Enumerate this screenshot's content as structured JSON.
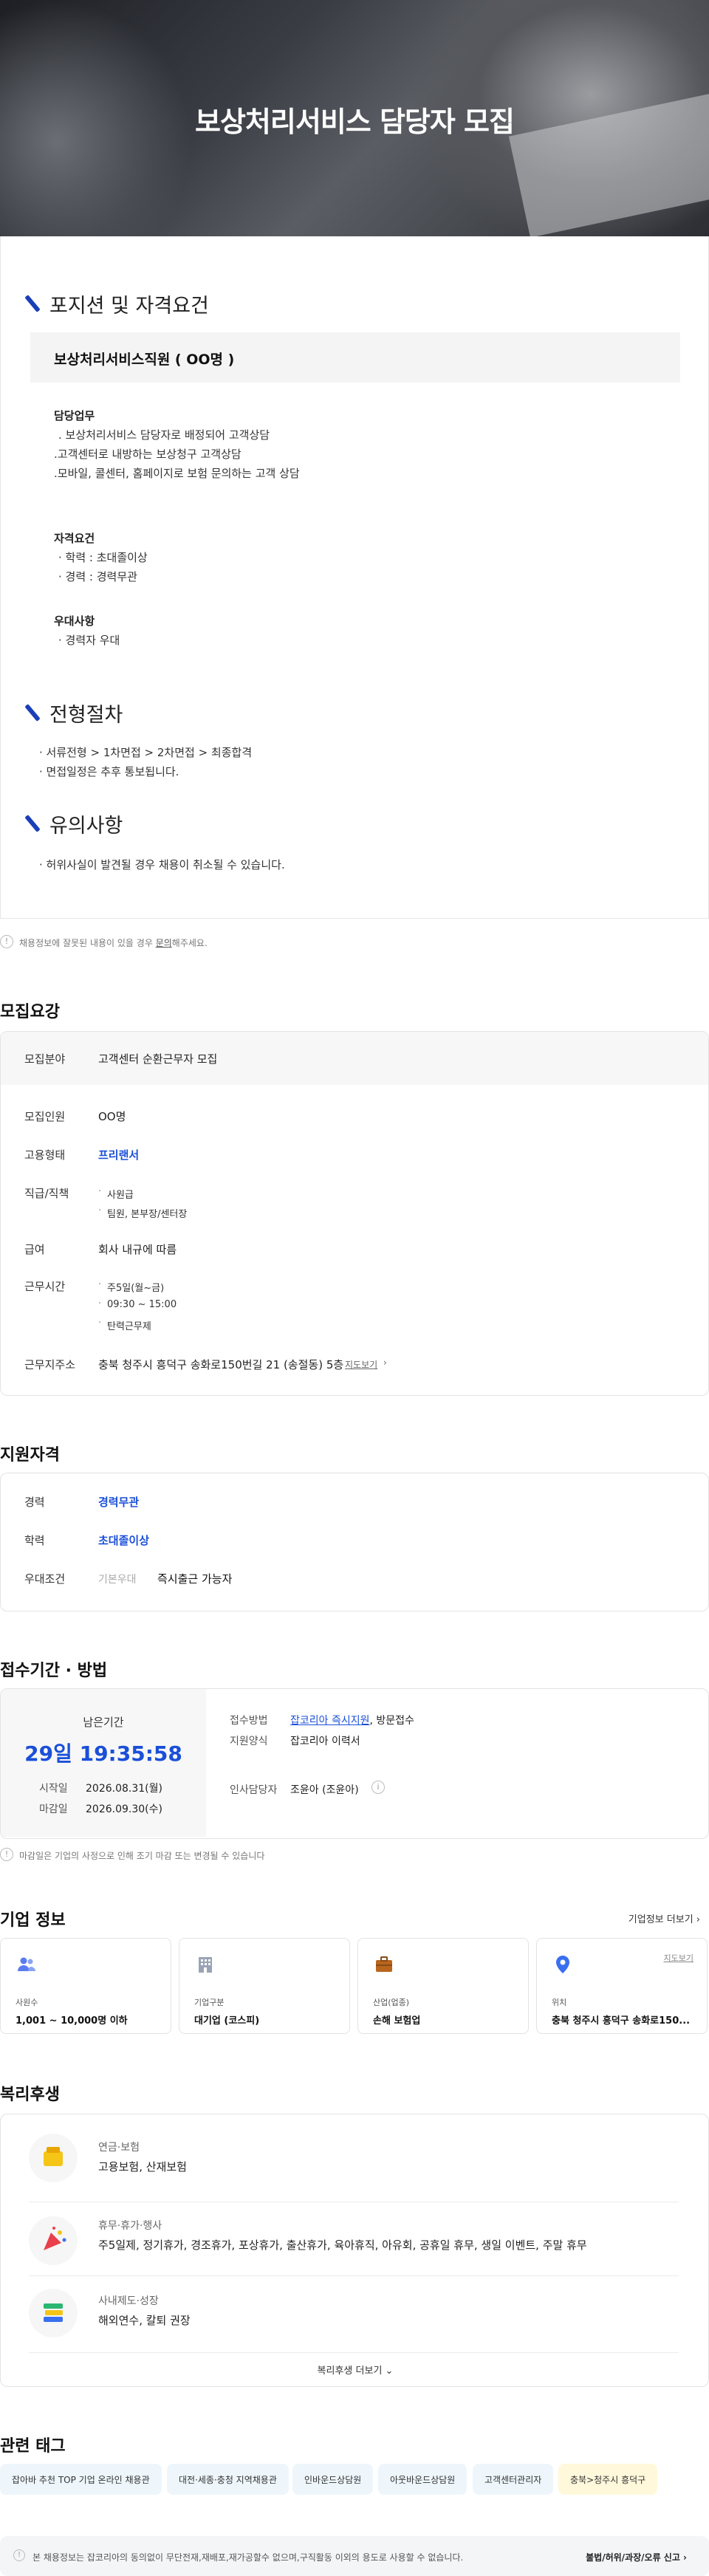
{
  "hero": {
    "title": "보상처리서비스 담당자 모집"
  },
  "detail": {
    "section1_title": "포지션 및 자격요건",
    "position": "보상처리서비스직원 ( OO명 )",
    "duty_label": "담당업무",
    "duties": [
      ". 보상처리서비스 담당자로 배정되어 고객상담",
      ".고객센터로 내방하는 보상청구 고객상담",
      ".모바일, 콜센터, 홈페이지로 보험 문의하는 고객 상담"
    ],
    "qual_label": "자격요건",
    "quals": [
      "· 학력 : 초대졸이상",
      "· 경력 : 경력무관"
    ],
    "pref_label": "우대사항",
    "prefs": [
      "· 경력자 우대"
    ],
    "section2_title": "전형절차",
    "process": [
      "· 서류전형 > 1차면접 > 2차면접 > 최종합격",
      "· 면접일정은 추후 통보됩니다."
    ],
    "section3_title": "유의사항",
    "notes": [
      "· 허위사실이 발견될 경우 채용이 취소될 수 있습니다."
    ]
  },
  "report": {
    "prefix": "채용정보에 잘못된 내용이 있을 경우 ",
    "link": "문의",
    "suffix": "해주세요."
  },
  "recruit": {
    "heading": "모집요강",
    "field_key": "모집분야",
    "field_val": "고객센터 순환근무자 모집",
    "count_key": "모집인원",
    "count_val": "OO명",
    "type_key": "고용형태",
    "type_val": "프리랜서",
    "rank_key": "직급/직책",
    "rank_vals": [
      "사원급",
      "팀원, 본부장/센터장"
    ],
    "pay_key": "급여",
    "pay_val": "회사 내규에 따름",
    "time_key": "근무시간",
    "time_vals": [
      "주5일(월~금)",
      "09:30 ~ 15:00",
      "탄력근무제"
    ],
    "addr_key": "근무지주소",
    "addr_val": "충북 청주시 흥덕구 송화로150번길 21 (송절동) 5층",
    "map": "지도보기"
  },
  "qual": {
    "heading": "지원자격",
    "career_key": "경력",
    "career_val": "경력무관",
    "edu_key": "학력",
    "edu_val": "초대졸이상",
    "pref_key": "우대조건",
    "pref_tag": "기본우대",
    "pref_val": "즉시출근 가능자"
  },
  "apply": {
    "heading": "접수기간 · 방법",
    "remain_label": "남은기간",
    "remain_val": "29일 19:35:58",
    "start_key": "시작일",
    "start_val": "2026.08.31(월)",
    "end_key": "마감일",
    "end_val": "2026.09.30(수)",
    "method_key": "접수방법",
    "method_link": "잡코리아 즉시지원",
    "method_rest": ", 방문접수",
    "form_key": "지원양식",
    "form_val": "잡코리아 이력서",
    "hr_key": "인사담당자",
    "hr_val": "조윤아 (조윤아)",
    "note": "마감일은 기업의 사정으로 인해 조기 마감 또는 변경될 수 있습니다"
  },
  "company": {
    "heading": "기업 정보",
    "more": "기업정보 더보기",
    "cards": [
      {
        "key": "사원수",
        "val": "1,001 ~ 10,000명 이하",
        "icon": "people-icon"
      },
      {
        "key": "기업구분",
        "val": "대기업 (코스피)",
        "icon": "building-icon"
      },
      {
        "key": "산업(업종)",
        "val": "손해 보험업",
        "icon": "briefcase-icon"
      },
      {
        "key": "위치",
        "val": "충북 청주시 흥덕구 송화로150...",
        "icon": "location-icon",
        "map": "지도보기"
      }
    ]
  },
  "welfare": {
    "heading": "복리후생",
    "items": [
      {
        "key": "연금·보험",
        "val": "고용보험, 산재보험"
      },
      {
        "key": "휴무·휴가·행사",
        "val": "주5일제, 정기휴가, 경조휴가, 포상휴가, 출산휴가, 육아휴직, 아유회, 공휴일 휴무, 생일 이벤트, 주말 휴무"
      },
      {
        "key": "사내제도·성장",
        "val": "해외연수, 칼퇴 권장"
      }
    ],
    "more": "복리후생 더보기"
  },
  "tags": {
    "heading": "관련 태그",
    "items": [
      "잡아바 추천 TOP 기업 온라인 채용관",
      "대전·세종·충청 지역채용관",
      "인바운드상담원",
      "아웃바운드상담원",
      "고객센터관리자",
      "충북>청주시 흥덕구"
    ]
  },
  "footer": {
    "text": "본 채용정보는 잡코리아의 동의없이 무단전재,재배포,재가공할수 없으며,구직활동 이외의 용도로 사용할 수 없습니다.",
    "report": "불법/허위/과장/오류 신고"
  },
  "colors": {
    "accent_blue": "#1a4fd8",
    "section_bar": "#1a3fb8"
  }
}
